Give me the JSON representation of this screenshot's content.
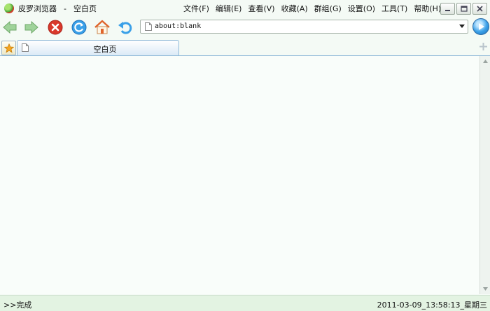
{
  "window": {
    "app_name": "皮罗浏览器",
    "separator": "-",
    "page_title": "空白页"
  },
  "menu": [
    {
      "label": "文件(F)"
    },
    {
      "label": "编辑(E)"
    },
    {
      "label": "查看(V)"
    },
    {
      "label": "收藏(A)"
    },
    {
      "label": "群组(G)"
    },
    {
      "label": "设置(O)"
    },
    {
      "label": "工具(T)"
    },
    {
      "label": "帮助(H)"
    }
  ],
  "toolbar": {
    "icons": [
      "back-arrow-icon",
      "forward-arrow-icon",
      "stop-icon",
      "refresh-icon",
      "home-icon",
      "undo-icon"
    ]
  },
  "address": {
    "value": "about:blank"
  },
  "tabs": [
    {
      "label": "空白页"
    }
  ],
  "status": {
    "left": ">>完成",
    "right": "2011-03-09_13:58:13_星期三"
  },
  "colors": {
    "background": "#f4faf5",
    "statusbar": "#e3f3e2",
    "accent_blue": "#3aa0e8",
    "stop_red": "#d9382b",
    "nav_green": "#6fbf6b"
  }
}
